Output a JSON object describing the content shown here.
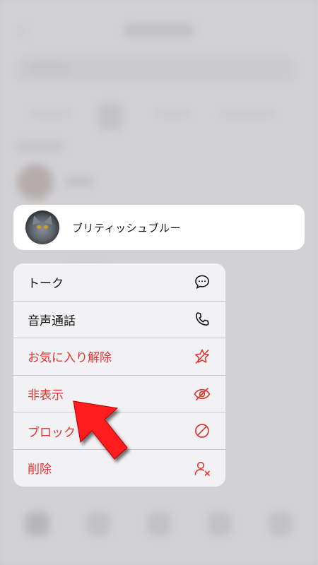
{
  "contact": {
    "name": "ブリティッシュブルー",
    "avatar_icon": "cat-avatar"
  },
  "menu": {
    "items": [
      {
        "label": "トーク",
        "icon": "chat-bubble-icon",
        "destructive": false
      },
      {
        "label": "音声通話",
        "icon": "phone-icon",
        "destructive": false
      },
      {
        "label": "お気に入り解除",
        "icon": "star-remove-icon",
        "destructive": true
      },
      {
        "label": "非表示",
        "icon": "eye-slash-icon",
        "destructive": true
      },
      {
        "label": "ブロック",
        "icon": "block-icon",
        "destructive": true
      },
      {
        "label": "削除",
        "icon": "person-remove-icon",
        "destructive": true
      }
    ]
  },
  "colors": {
    "destructive": "#e0352f",
    "annotation_arrow": "#ff1a1a"
  }
}
